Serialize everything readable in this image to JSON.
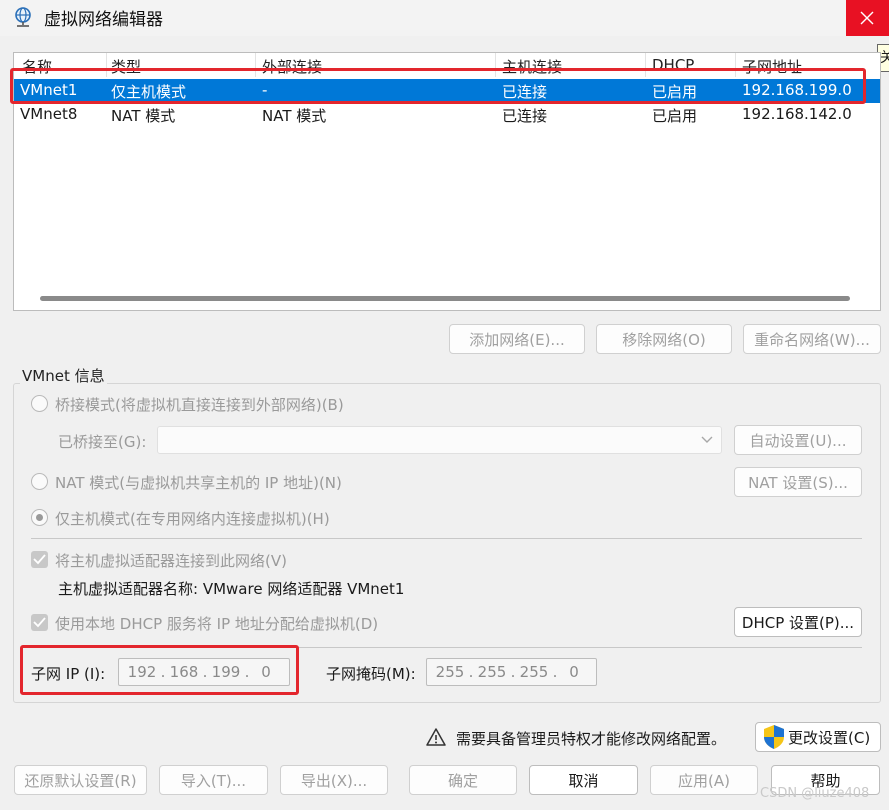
{
  "window": {
    "title": "虚拟网络编辑器",
    "tooltip_fragment": "关"
  },
  "list": {
    "columns": [
      "名称",
      "类型",
      "外部连接",
      "主机连接",
      "DHCP",
      "子网地址"
    ],
    "rows": [
      {
        "name": "VMnet1",
        "type": "仅主机模式",
        "external": "-",
        "host": "已连接",
        "dhcp": "已启用",
        "subnet": "192.168.199.0",
        "selected": true
      },
      {
        "name": "VMnet8",
        "type": "NAT 模式",
        "external": "NAT 模式",
        "host": "已连接",
        "dhcp": "已启用",
        "subnet": "192.168.142.0",
        "selected": false
      }
    ]
  },
  "list_buttons": {
    "add": "添加网络(E)...",
    "remove": "移除网络(O)",
    "rename": "重命名网络(W)..."
  },
  "vmnet_info": {
    "group_label": "VMnet 信息",
    "bridge_label": "桥接模式(将虚拟机直接连接到外部网络)(B)",
    "bridged_to_label": "已桥接至(G):",
    "bridged_to_value": "",
    "auto_settings": "自动设置(U)...",
    "nat_label": "NAT 模式(与虚拟机共享主机的 IP 地址)(N)",
    "nat_settings": "NAT 设置(S)...",
    "hostonly_label": "仅主机模式(在专用网络内连接虚拟机)(H)",
    "connect_adapter_label": "将主机虚拟适配器连接到此网络(V)",
    "adapter_name_label": "主机虚拟适配器名称: VMware 网络适配器 VMnet1",
    "dhcp_label": "使用本地 DHCP 服务将 IP 地址分配给虚拟机(D)",
    "dhcp_settings": "DHCP 设置(P)...",
    "subnet_ip_label": "子网 IP (I):",
    "subnet_ip": [
      "192",
      "168",
      "199",
      "0"
    ],
    "subnet_mask_label": "子网掩码(M):",
    "subnet_mask": [
      "255",
      "255",
      "255",
      "0"
    ],
    "selected_mode": "hostonly"
  },
  "footer": {
    "admin_notice": "需要具备管理员特权才能修改网络配置。",
    "change_settings": "更改设置(C)",
    "restore_defaults": "还原默认设置(R)",
    "import": "导入(T)...",
    "export": "导出(X)...",
    "ok": "确定",
    "cancel": "取消",
    "apply": "应用(A)",
    "help": "帮助"
  },
  "watermark": "CSDN @liuze408",
  "icons": {
    "app": "globe-network-icon",
    "close": "close-icon",
    "warning": "warning-triangle-icon",
    "shield": "uac-shield-icon",
    "dropdown": "chevron-down-icon"
  },
  "colors": {
    "selection": "#0078d7",
    "close": "#e81123",
    "annotation": "#e3262d"
  }
}
